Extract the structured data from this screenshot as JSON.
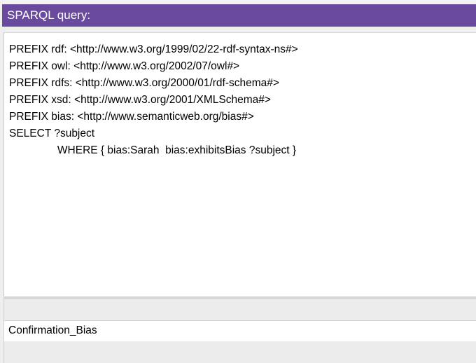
{
  "header": {
    "title": "SPARQL query:"
  },
  "query": {
    "text": "PREFIX rdf: <http://www.w3.org/1999/02/22-rdf-syntax-ns#>\nPREFIX owl: <http://www.w3.org/2002/07/owl#>\nPREFIX rdfs: <http://www.w3.org/2000/01/rdf-schema#>\nPREFIX xsd: <http://www.w3.org/2001/XMLSchema#>\nPREFIX bias: <http://www.semanticweb.org/bias#>\nSELECT ?subject\n                WHERE { bias:Sarah  bias:exhibitsBias ?subject }"
  },
  "results": {
    "rows": [
      {
        "value": "Confirmation_Bias"
      }
    ]
  },
  "colors": {
    "header_bg": "#6a4a9e",
    "header_text": "#ffffff",
    "editor_bg": "#ffffff",
    "panel_bg": "#efefef"
  }
}
